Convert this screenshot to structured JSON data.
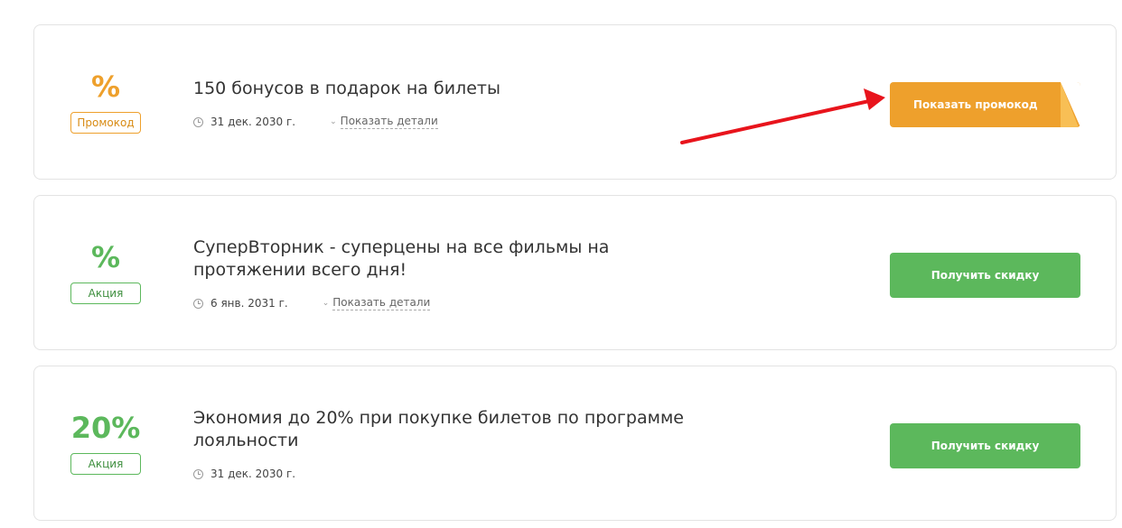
{
  "offers": [
    {
      "discount": "%",
      "tag": "Промокод",
      "title": "150 бонусов в подарок на билеты",
      "date": "31 дек. 2030 г.",
      "details_label": "Показать детали",
      "button_label": "Показать промокод",
      "color": "#eea02c"
    },
    {
      "discount": "%",
      "tag": "Акция",
      "title": "СуперВторник - суперцены на все фильмы на протяжении всего дня!",
      "date": "6 янв. 2031 г.",
      "details_label": "Показать детали",
      "button_label": "Получить скидку",
      "color": "#5cb85c"
    },
    {
      "discount": "20%",
      "tag": "Акция",
      "title": "Экономия до 20% при покупке билетов по программе лояльности",
      "date": "31 дек. 2030 г.",
      "button_label": "Получить скидку",
      "color": "#5cb85c"
    }
  ],
  "annotation": {
    "arrow_color": "#e8141c",
    "arrow_icon": "red-arrow-pointer"
  }
}
